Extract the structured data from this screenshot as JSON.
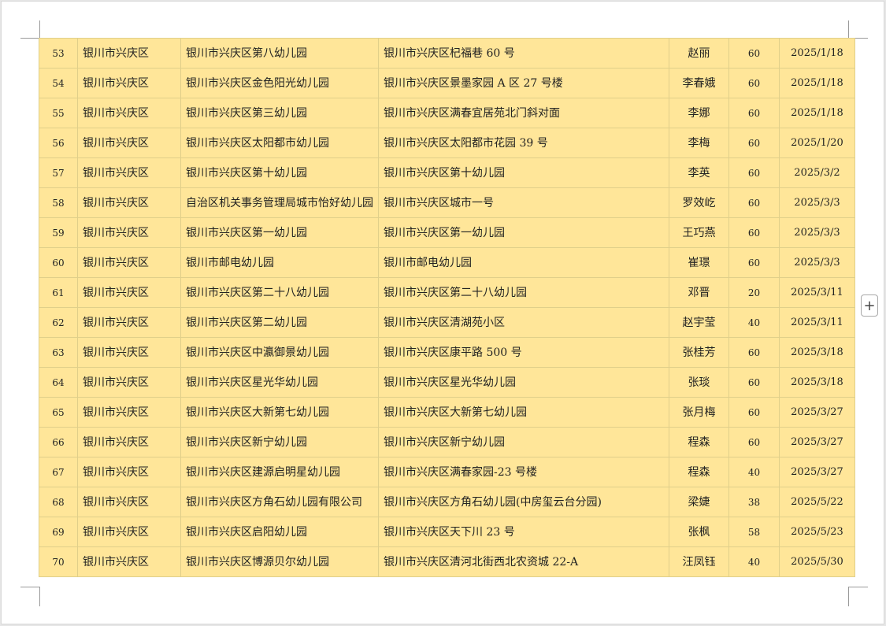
{
  "table": {
    "rows": [
      [
        "53",
        "银川市兴庆区",
        "银川市兴庆区第八幼儿园",
        "银川市兴庆区杞福巷 60 号",
        "赵丽",
        "60",
        "2025/1/18"
      ],
      [
        "54",
        "银川市兴庆区",
        "银川市兴庆区金色阳光幼儿园",
        "银川市兴庆区景墨家园 A 区 27 号楼",
        "李春娥",
        "60",
        "2025/1/18"
      ],
      [
        "55",
        "银川市兴庆区",
        "银川市兴庆区第三幼儿园",
        "银川市兴庆区满春宜居苑北门斜对面",
        "李娜",
        "60",
        "2025/1/18"
      ],
      [
        "56",
        "银川市兴庆区",
        "银川市兴庆区太阳都市幼儿园",
        "银川市兴庆区太阳都市花园 39 号",
        "李梅",
        "60",
        "2025/1/20"
      ],
      [
        "57",
        "银川市兴庆区",
        "银川市兴庆区第十幼儿园",
        "银川市兴庆区第十幼儿园",
        "李英",
        "60",
        "2025/3/2"
      ],
      [
        "58",
        "银川市兴庆区",
        "自治区机关事务管理局城市怡好幼儿园",
        "银川市兴庆区城市一号",
        "罗效屹",
        "60",
        "2025/3/3"
      ],
      [
        "59",
        "银川市兴庆区",
        "银川市兴庆区第一幼儿园",
        "银川市兴庆区第一幼儿园",
        "王巧燕",
        "60",
        "2025/3/3"
      ],
      [
        "60",
        "银川市兴庆区",
        "银川市邮电幼儿园",
        "银川市邮电幼儿园",
        "崔璟",
        "60",
        "2025/3/3"
      ],
      [
        "61",
        "银川市兴庆区",
        "银川市兴庆区第二十八幼儿园",
        "银川市兴庆区第二十八幼儿园",
        "邓晋",
        "20",
        "2025/3/11"
      ],
      [
        "62",
        "银川市兴庆区",
        "银川市兴庆区第二幼儿园",
        "银川市兴庆区清湖苑小区",
        "赵宇莹",
        "40",
        "2025/3/11"
      ],
      [
        "63",
        "银川市兴庆区",
        "银川市兴庆区中瀛御景幼儿园",
        "银川市兴庆区康平路 500 号",
        "张桂芳",
        "60",
        "2025/3/18"
      ],
      [
        "64",
        "银川市兴庆区",
        "银川市兴庆区星光华幼儿园",
        "银川市兴庆区星光华幼儿园",
        "张琰",
        "60",
        "2025/3/18"
      ],
      [
        "65",
        "银川市兴庆区",
        "银川市兴庆区大新第七幼儿园",
        "银川市兴庆区大新第七幼儿园",
        "张月梅",
        "60",
        "2025/3/27"
      ],
      [
        "66",
        "银川市兴庆区",
        "银川市兴庆区新宁幼儿园",
        "银川市兴庆区新宁幼儿园",
        "程森",
        "60",
        "2025/3/27"
      ],
      [
        "67",
        "银川市兴庆区",
        "银川市兴庆区建源启明星幼儿园",
        "银川市兴庆区满春家园-23 号楼",
        "程森",
        "40",
        "2025/3/27"
      ],
      [
        "68",
        "银川市兴庆区",
        "银川市兴庆区方角石幼儿园有限公司",
        "银川市兴庆区方角石幼儿园(中房玺云台分园)",
        "梁婕",
        "38",
        "2025/5/22"
      ],
      [
        "69",
        "银川市兴庆区",
        "银川市兴庆区启阳幼儿园",
        "银川市兴庆区天下川 23 号",
        "张枫",
        "58",
        "2025/5/23"
      ],
      [
        "70",
        "银川市兴庆区",
        "银川市兴庆区博源贝尔幼儿园",
        "银川市兴庆区清河北街西北农资城 22-A",
        "汪凤钰",
        "40",
        "2025/5/30"
      ]
    ]
  },
  "add_button": {
    "label": "+"
  }
}
